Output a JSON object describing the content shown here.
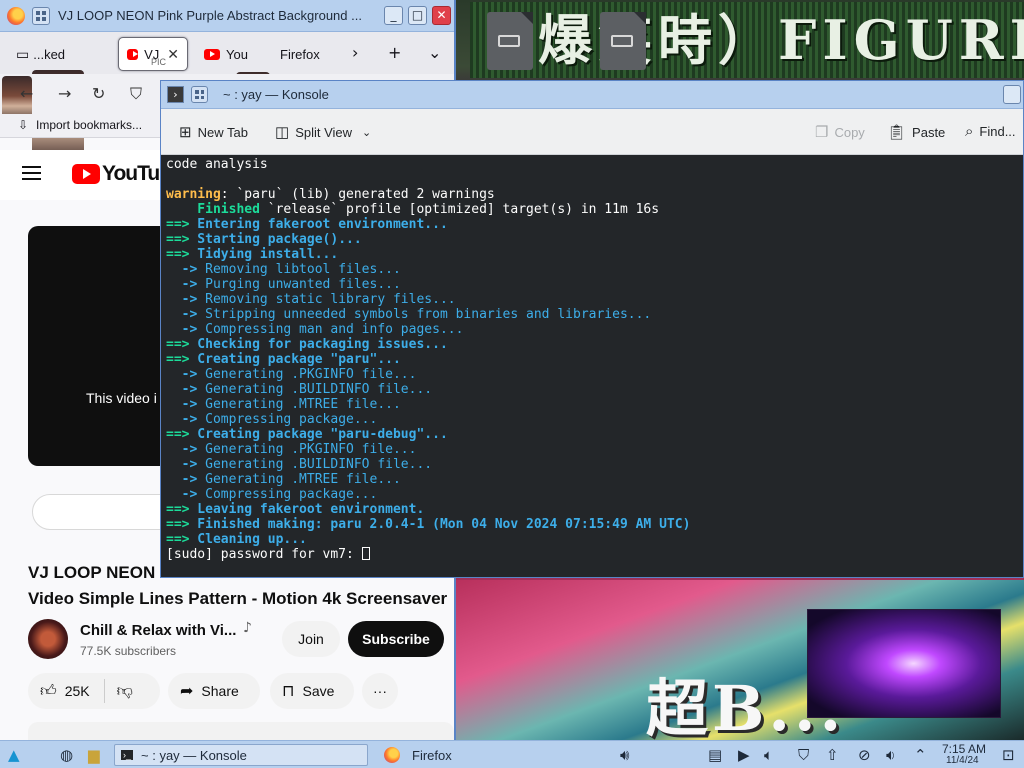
{
  "desktop": {
    "banner_text": "（爆笑時）FIGURE",
    "bottom_text": "超B..."
  },
  "firefox": {
    "window_title": "VJ LOOP NEON Pink Purple Abstract Background ...",
    "tabs": [
      {
        "label": "...ked"
      },
      {
        "label": "VJ",
        "sub": "PIC"
      },
      {
        "label": "You"
      },
      {
        "label": "Firefox"
      }
    ],
    "bookmarks_label": "Import bookmarks...",
    "youtube": {
      "logo_text": "YouTube",
      "player_message": "This video i",
      "title_line1": "VJ LOOP NEON",
      "title_line2": "Video Simple Lines Pattern - Motion 4k Screensaver",
      "channel_name": "Chill & Relax with Vi...",
      "subscribers": "77.5K subscribers",
      "join_label": "Join",
      "subscribe_label": "Subscribe",
      "like_count": "25K",
      "share_label": "Share",
      "save_label": "Save",
      "more_label": "···"
    }
  },
  "konsole": {
    "window_title": "~ : yay — Konsole",
    "toolbar": {
      "new_tab": "New Tab",
      "split_view": "Split View",
      "copy": "Copy",
      "paste": "Paste",
      "find": "Find..."
    },
    "lines": [
      {
        "parts": [
          {
            "t": "code analysis",
            "c": ""
          }
        ]
      },
      {
        "parts": [
          {
            "t": "",
            "c": ""
          }
        ]
      },
      {
        "parts": [
          {
            "t": "warning",
            "c": "t-warn"
          },
          {
            "t": ": `paru` (lib) generated 2 warnings",
            "c": ""
          }
        ]
      },
      {
        "parts": [
          {
            "t": "    Finished",
            "c": "t-green"
          },
          {
            "t": " `release` profile [optimized] target(s) in 11m 16s",
            "c": ""
          }
        ]
      },
      {
        "parts": [
          {
            "t": "==>",
            "c": "t-green"
          },
          {
            "t": " Entering fakeroot environment...",
            "c": "t-blue"
          }
        ]
      },
      {
        "parts": [
          {
            "t": "==>",
            "c": "t-green"
          },
          {
            "t": " Starting package()...",
            "c": "t-blue"
          }
        ]
      },
      {
        "parts": [
          {
            "t": "==>",
            "c": "t-green"
          },
          {
            "t": " Tidying install...",
            "c": "t-blue"
          }
        ]
      },
      {
        "parts": [
          {
            "t": "  ->",
            "c": "t-blue"
          },
          {
            "t": " Removing libtool files...",
            "c": "t-dim"
          }
        ]
      },
      {
        "parts": [
          {
            "t": "  ->",
            "c": "t-blue"
          },
          {
            "t": " Purging unwanted files...",
            "c": "t-dim"
          }
        ]
      },
      {
        "parts": [
          {
            "t": "  ->",
            "c": "t-blue"
          },
          {
            "t": " Removing static library files...",
            "c": "t-dim"
          }
        ]
      },
      {
        "parts": [
          {
            "t": "  ->",
            "c": "t-blue"
          },
          {
            "t": " Stripping unneeded symbols from binaries and libraries...",
            "c": "t-dim"
          }
        ]
      },
      {
        "parts": [
          {
            "t": "  ->",
            "c": "t-blue"
          },
          {
            "t": " Compressing man and info pages...",
            "c": "t-dim"
          }
        ]
      },
      {
        "parts": [
          {
            "t": "==>",
            "c": "t-green"
          },
          {
            "t": " Checking for packaging issues...",
            "c": "t-blue"
          }
        ]
      },
      {
        "parts": [
          {
            "t": "==>",
            "c": "t-green"
          },
          {
            "t": " Creating package \"paru\"...",
            "c": "t-blue"
          }
        ]
      },
      {
        "parts": [
          {
            "t": "  ->",
            "c": "t-blue"
          },
          {
            "t": " Generating .PKGINFO file...",
            "c": "t-dim"
          }
        ]
      },
      {
        "parts": [
          {
            "t": "  ->",
            "c": "t-blue"
          },
          {
            "t": " Generating .BUILDINFO file...",
            "c": "t-dim"
          }
        ]
      },
      {
        "parts": [
          {
            "t": "  ->",
            "c": "t-blue"
          },
          {
            "t": " Generating .MTREE file...",
            "c": "t-dim"
          }
        ]
      },
      {
        "parts": [
          {
            "t": "  ->",
            "c": "t-blue"
          },
          {
            "t": " Compressing package...",
            "c": "t-dim"
          }
        ]
      },
      {
        "parts": [
          {
            "t": "==>",
            "c": "t-green"
          },
          {
            "t": " Creating package \"paru-debug\"...",
            "c": "t-blue"
          }
        ]
      },
      {
        "parts": [
          {
            "t": "  ->",
            "c": "t-blue"
          },
          {
            "t": " Generating .PKGINFO file...",
            "c": "t-dim"
          }
        ]
      },
      {
        "parts": [
          {
            "t": "  ->",
            "c": "t-blue"
          },
          {
            "t": " Generating .BUILDINFO file...",
            "c": "t-dim"
          }
        ]
      },
      {
        "parts": [
          {
            "t": "  ->",
            "c": "t-blue"
          },
          {
            "t": " Generating .MTREE file...",
            "c": "t-dim"
          }
        ]
      },
      {
        "parts": [
          {
            "t": "  ->",
            "c": "t-blue"
          },
          {
            "t": " Compressing package...",
            "c": "t-dim"
          }
        ]
      },
      {
        "parts": [
          {
            "t": "==>",
            "c": "t-green"
          },
          {
            "t": " Leaving fakeroot environment.",
            "c": "t-blue"
          }
        ]
      },
      {
        "parts": [
          {
            "t": "==>",
            "c": "t-green"
          },
          {
            "t": " Finished making: paru 2.0.4-1 (Mon 04 Nov 2024 07:15:49 AM UTC)",
            "c": "t-blue"
          }
        ]
      },
      {
        "parts": [
          {
            "t": "==>",
            "c": "t-green"
          },
          {
            "t": " Cleaning up...",
            "c": "t-blue"
          }
        ]
      }
    ],
    "prompt": "[sudo] password for vm7: "
  },
  "taskbar": {
    "konsole_task": "~ : yay — Konsole",
    "firefox_task": "Firefox",
    "time": "7:15 AM",
    "date": "11/4/24"
  }
}
